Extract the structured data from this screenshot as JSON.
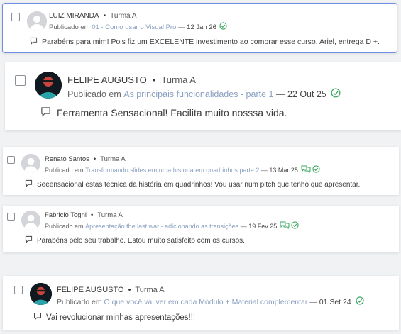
{
  "colors": {
    "accent_green": "#3aa860",
    "link": "#8aa0c0",
    "selected_border": "#6f8fe6",
    "avatar_placeholder": "#d3d5d9"
  },
  "comments": [
    {
      "author": "LUIZ MIRANDA",
      "group": "Turma A",
      "published_prefix": "Publicado em",
      "lesson": "01 - Como usar o Visual Pro",
      "separator": "—",
      "date": "12 Jan 26",
      "text": "Parabéns para mim! Pois fiz um EXCELENTE investimento ao comprar esse curso. Ariel, entrega D +.",
      "avatar": "placeholder-avatar",
      "status_icon": "check-circle-icon",
      "replied": false,
      "selected": true
    },
    {
      "author": "FELIPE AUGUSTO",
      "group": "Turma A",
      "published_prefix": "Publicado em",
      "lesson": "As principais funcionalidades - parte 1",
      "separator": "—",
      "date": "22 Out 25",
      "text": "Ferramenta Sensacional! Facilita muito nosssa vida.",
      "avatar": "photo-avatar",
      "status_icon": "check-circle-icon",
      "replied": false,
      "selected": false
    },
    {
      "author": "Renato Santos",
      "group": "Turma A",
      "published_prefix": "Publicado em",
      "lesson": "Transformando slides em uma historia em quadrinhos parte 2",
      "separator": "—",
      "date": "13 Mar 25",
      "text": "Seeensacional estas técnica da história em quadrinhos! Vou usar num pitch que tenho que apresentar.",
      "avatar": "placeholder-avatar",
      "status_icon": "check-circle-icon",
      "replied": true,
      "selected": false
    },
    {
      "author": "Fabricio Togni",
      "group": "Turma A",
      "published_prefix": "Publicado em",
      "lesson": "Apresentação the last war - adicionando as transições",
      "separator": "—",
      "date": "19 Fev 25",
      "text": "Parabéns pelo seu trabalho. Estou muito satisfeito com os cursos.",
      "avatar": "placeholder-avatar",
      "status_icon": "check-circle-icon",
      "replied": true,
      "selected": false
    },
    {
      "author": "FELIPE AUGUSTO",
      "group": "Turma A",
      "published_prefix": "Publicado em",
      "lesson": "O que você vai ver em cada Módulo + Material complementar",
      "separator": "—",
      "date": "01 Set 24",
      "text": "Vai revolucionar minhas apresentações!!!",
      "avatar": "photo-avatar",
      "status_icon": "check-circle-icon",
      "replied": false,
      "selected": false
    }
  ]
}
